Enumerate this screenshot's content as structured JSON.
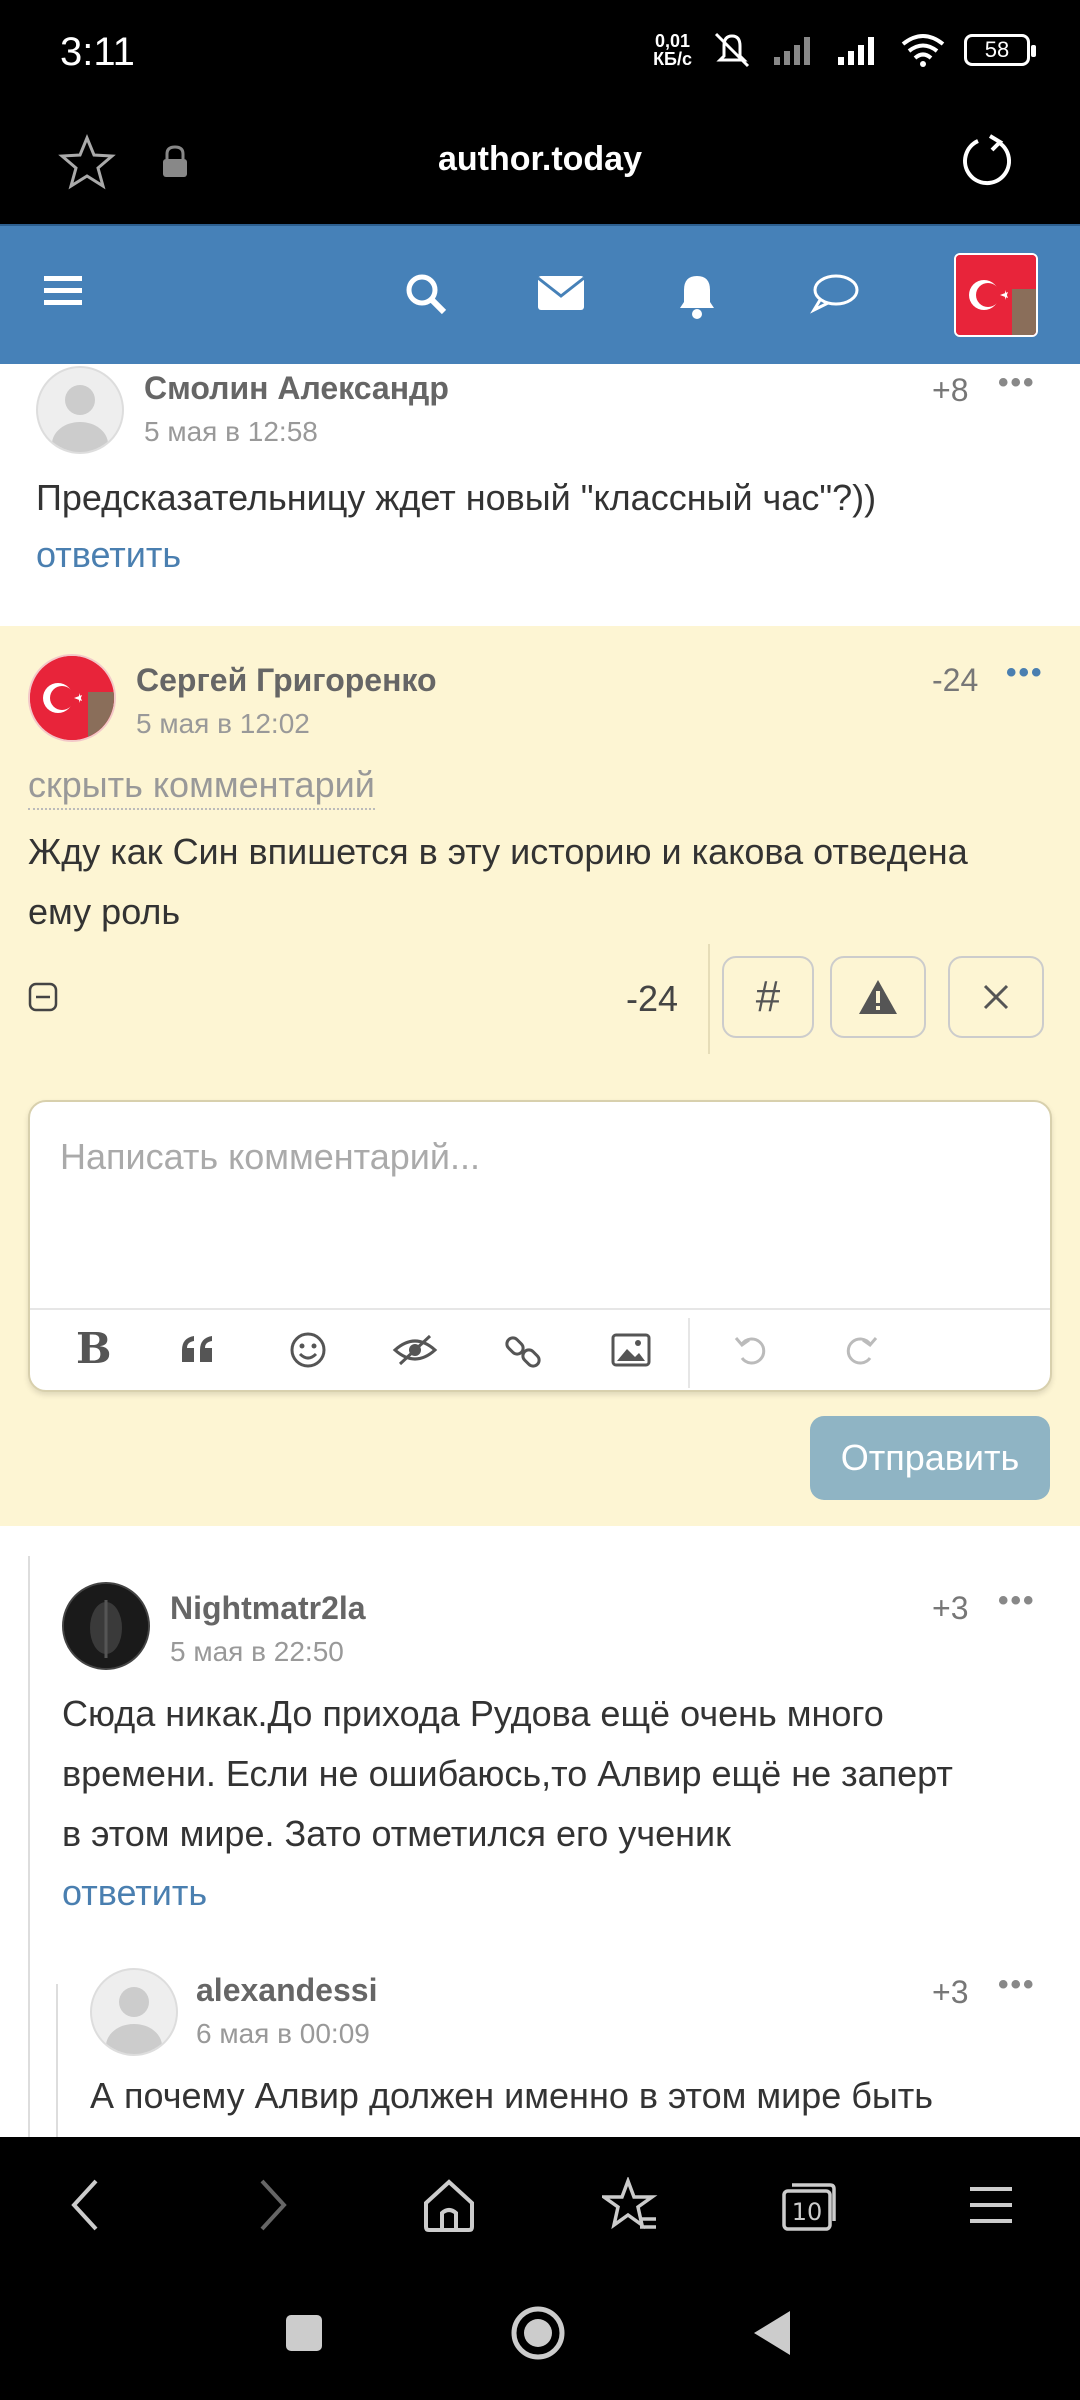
{
  "status_bar": {
    "time": "3:11",
    "net_speed_top": "0,01",
    "net_speed_bottom": "КБ/с",
    "battery": "58"
  },
  "browser": {
    "url": "author.today"
  },
  "comments": [
    {
      "author": "Смолин Александр",
      "date": "5 мая в 12:58",
      "score": "+8",
      "text": "Предсказательницу ждет новый \"классный час\"?))",
      "reply": "ответить"
    },
    {
      "author": "Сергей Григоренко",
      "date": "5 мая в 12:02",
      "score": "-24",
      "hide_label": "скрыть комментарий",
      "text_line1": "Жду как Син впишется в эту историю и какова отведена",
      "text_line2": "ему роль"
    },
    {
      "author": "Nightmatr2la",
      "date": "5 мая в 22:50",
      "score": "+3",
      "text_line1": "Сюда никак.До прихода Рудова ещё очень много",
      "text_line2": "времени. Если не ошибаюсь,то Алвир ещё не заперт",
      "text_line3": "в этом мире. Зато отметился его ученик",
      "reply": "ответить"
    },
    {
      "author": "alexandessi",
      "date": "6 мая в 00:09",
      "score": "+3",
      "text": "А почему Алвир должен именно в этом мире быть"
    }
  ],
  "actions": {
    "score": "-24",
    "hash": "#"
  },
  "editor": {
    "placeholder": "Написать комментарий...",
    "bold": "B",
    "submit": "Отправить"
  },
  "colors": {
    "navbar": "#4681b8",
    "highlight": "#fdf5d3",
    "link": "#4a7fb0",
    "submit": "#8fb4c4"
  }
}
